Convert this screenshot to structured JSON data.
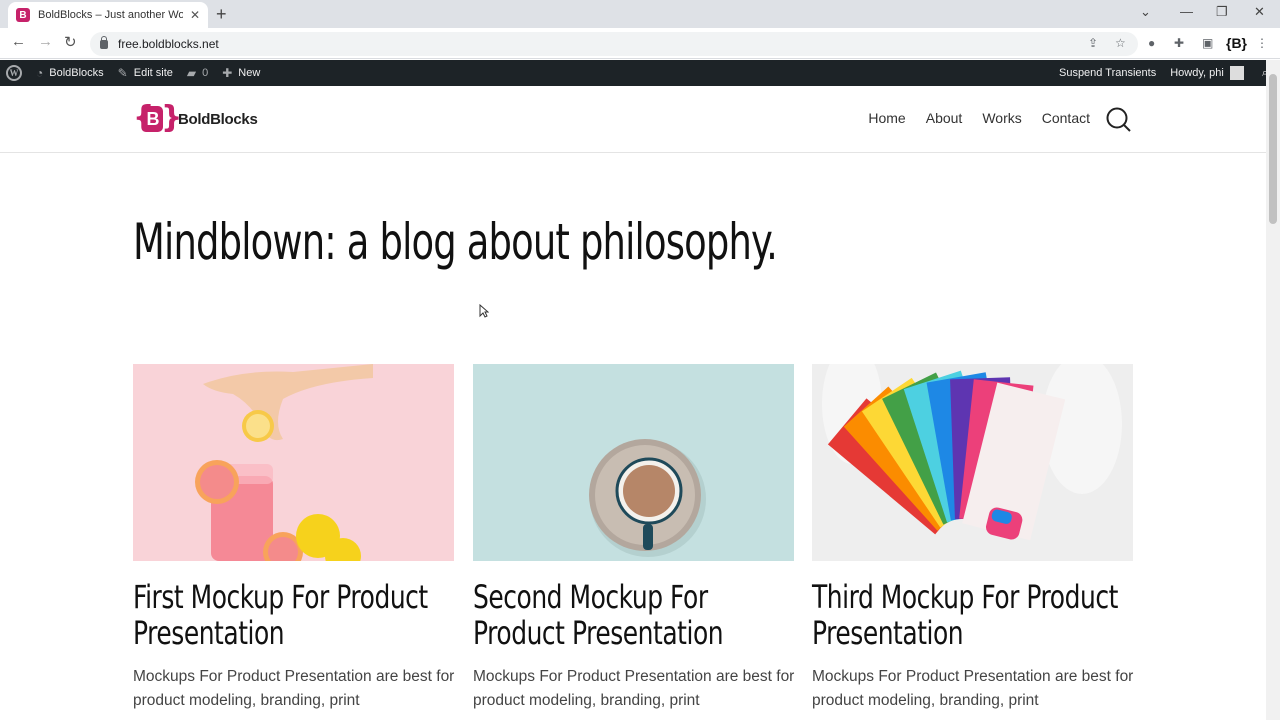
{
  "browser": {
    "tab_title": "BoldBlocks – Just another WordP",
    "tab_favicon": "B",
    "url": "free.boldblocks.net"
  },
  "adminbar": {
    "site_name": "BoldBlocks",
    "edit_site": "Edit site",
    "comments_count": "0",
    "new_label": "New",
    "suspend": "Suspend Transients",
    "howdy": "Howdy, phi"
  },
  "site": {
    "logo_text": "BoldBlocks",
    "nav": [
      "Home",
      "About",
      "Works",
      "Contact"
    ]
  },
  "main": {
    "headline": "Mindblown: a blog about philosophy.",
    "posts": [
      {
        "title": "First Mockup For Product Presentation",
        "excerpt": "Mockups For Product Presentation are best for product modeling, branding, print"
      },
      {
        "title": "Second Mockup For Product Presentation",
        "excerpt": "Mockups For Product Presentation are best for product modeling, branding, print"
      },
      {
        "title": "Third Mockup For Product Presentation",
        "excerpt": "Mockups For Product Presentation are best for product modeling, branding, print"
      }
    ]
  },
  "colors": {
    "brand": "#c6226a",
    "adminbar": "#1d2327"
  }
}
